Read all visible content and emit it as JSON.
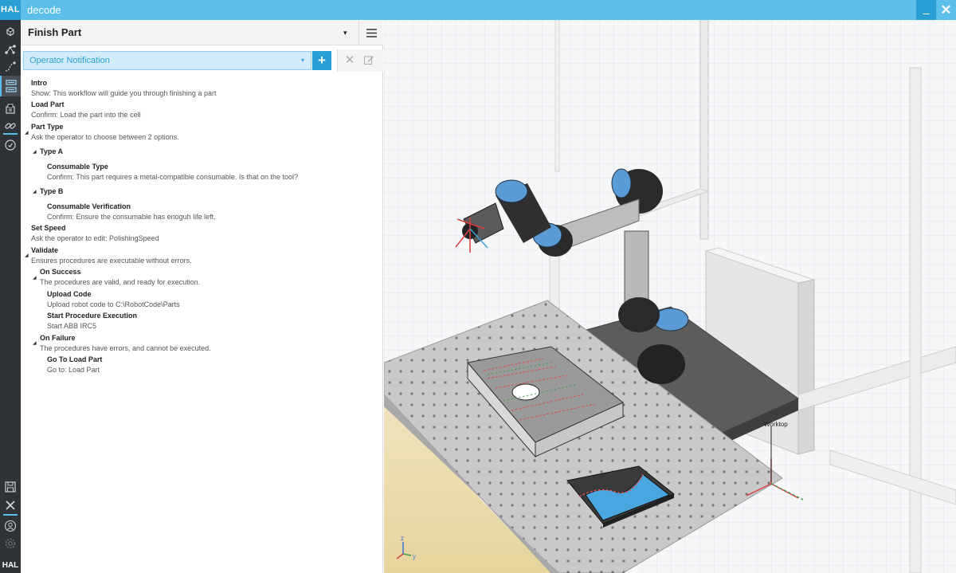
{
  "app": {
    "logo": "HAL",
    "title": "decode",
    "minimize": "_",
    "close": "✕"
  },
  "rail": {
    "bottom_logo": "HAL"
  },
  "workflow": {
    "title": "Finish Part",
    "caret": "▾"
  },
  "step_selector": {
    "selected": "Operator Notification",
    "caret": "▾",
    "add_label": "+",
    "delete_label": "✕"
  },
  "steps": [
    {
      "title": "Intro",
      "desc": "Show: This workflow will guide you through finishing a part"
    },
    {
      "title": "Load Part",
      "desc": "Confirm: Load the part into the cell"
    },
    {
      "title": "Part Type",
      "desc": "Ask the operator to choose between 2 options."
    },
    {
      "title": "Type A"
    },
    {
      "title": "Consumable Type",
      "desc": "Confirm: This part requires a metal-compatible consumable. Is that on the tool?"
    },
    {
      "title": "Type B"
    },
    {
      "title": "Consumable Verification",
      "desc": "Confirm: Ensure the consumable has enoguh life left."
    },
    {
      "title": "Set Speed",
      "desc": "Ask the operator to edit: PolishingSpeed"
    },
    {
      "title": "Validate",
      "desc": "Ensures procedures are executable without errors."
    },
    {
      "title": "On Success",
      "desc": "The procedures are valid, and ready for execution."
    },
    {
      "title": "Upload Code",
      "desc": "Upload robot code to C:\\RobotCode\\Parts"
    },
    {
      "title": "Start Procedure Execution",
      "desc": "Start ABB IRC5"
    },
    {
      "title": "On Failure",
      "desc": "The procedures have errors, and cannot be executed."
    },
    {
      "title": "Go To Load Part",
      "desc": "Go to: Load Part"
    }
  ],
  "viewport": {
    "worktop_label": "Worktop",
    "axis_z": "z",
    "axis_y": "y"
  },
  "colors": {
    "accent": "#5bbfe9",
    "accent_dark": "#2a9fd6",
    "rail": "#2f3337",
    "robot_blue": "#5b9bd5"
  }
}
